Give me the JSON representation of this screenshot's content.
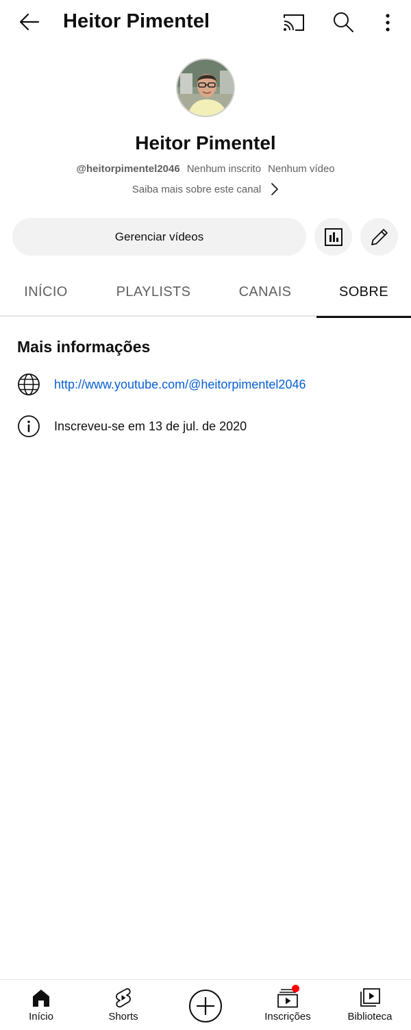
{
  "header": {
    "title": "Heitor Pimentel",
    "back_icon": "arrow-left-icon",
    "cast_icon": "cast-icon",
    "search_icon": "search-icon",
    "more_icon": "more-vert-icon"
  },
  "channel": {
    "name": "Heitor Pimentel",
    "handle": "@heitorpimentel2046",
    "subscribers": "Nenhum inscrito",
    "videos": "Nenhum vídeo",
    "about_link": "Saiba mais sobre este canal"
  },
  "actions": {
    "manage_label": "Gerenciar vídeos",
    "stats_icon": "analytics-icon",
    "edit_icon": "edit-pencil-icon"
  },
  "tabs": [
    {
      "label": "INÍCIO",
      "active": false
    },
    {
      "label": "PLAYLISTS",
      "active": false
    },
    {
      "label": "CANAIS",
      "active": false
    },
    {
      "label": "SOBRE",
      "active": true
    }
  ],
  "about": {
    "section_title": "Mais informações",
    "link": "http://www.youtube.com/@heitorpimentel2046",
    "joined": "Inscreveu-se em 13 de jul. de 2020"
  },
  "bottom_nav": {
    "home": "Início",
    "shorts": "Shorts",
    "subscriptions": "Inscrições",
    "library": "Biblioteca"
  },
  "colors": {
    "link": "#065fd4",
    "notification_dot": "#ff0000",
    "button_bg": "#f2f2f2"
  }
}
